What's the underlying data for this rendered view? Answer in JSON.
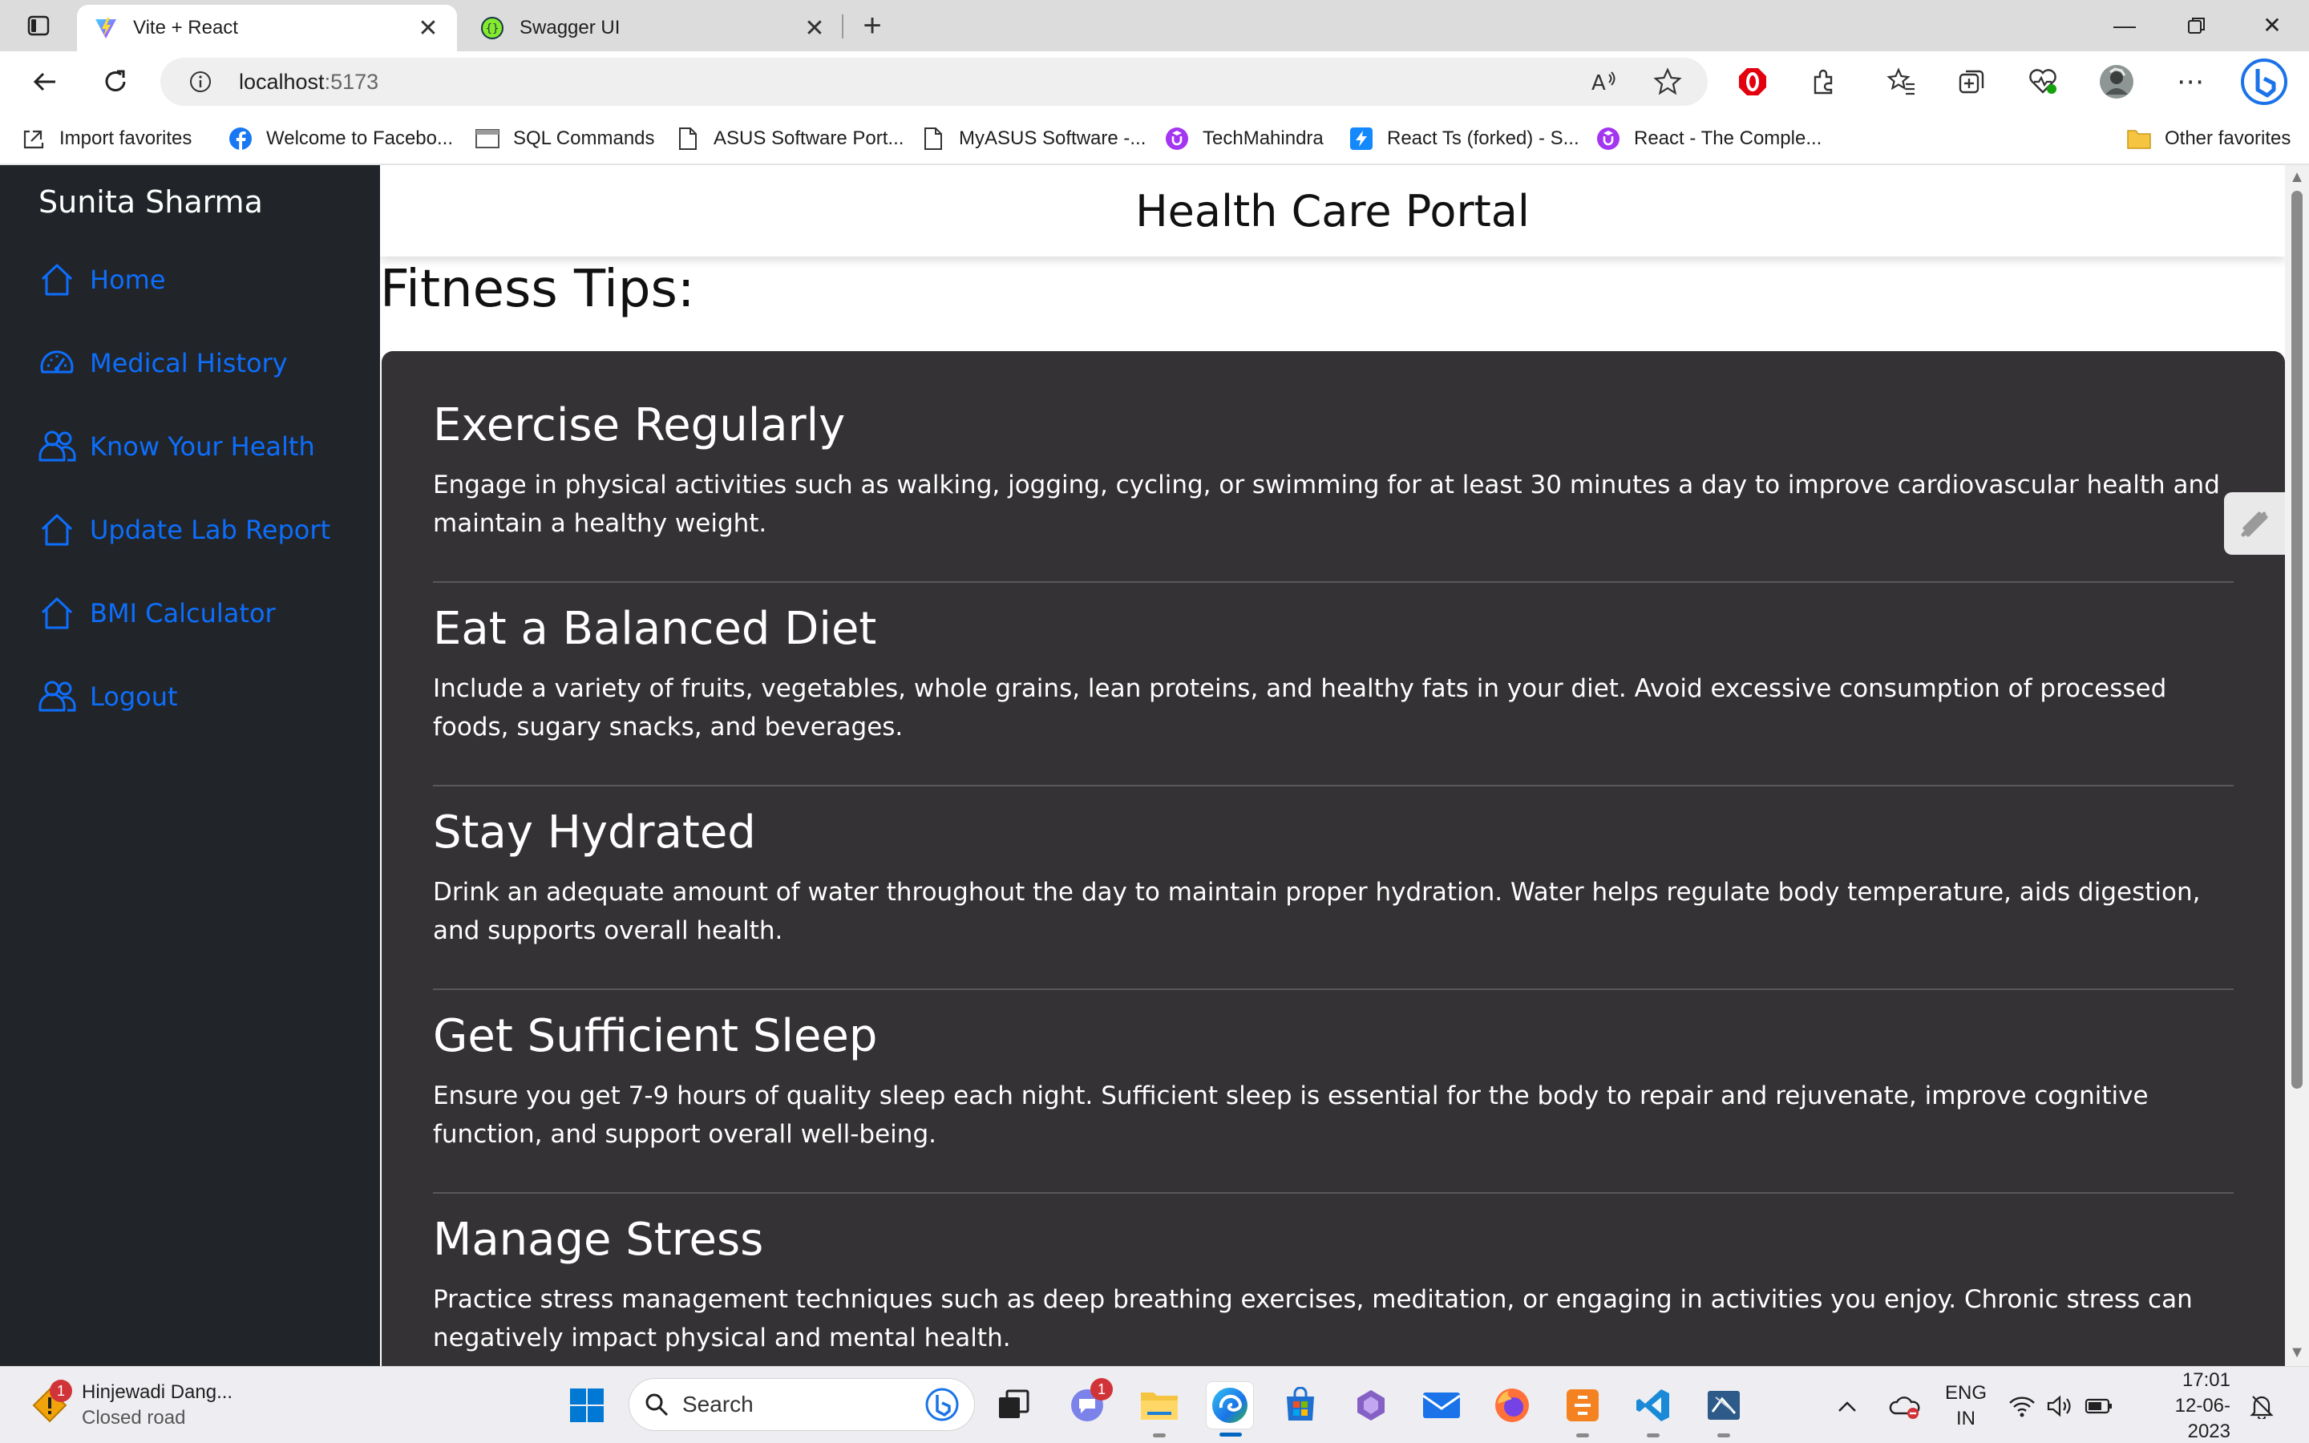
{
  "browser": {
    "tabs": [
      {
        "title": "Vite + React",
        "active": true,
        "icon": "vite-icon"
      },
      {
        "title": "Swagger UI",
        "active": false,
        "icon": "swagger-icon"
      }
    ],
    "address": {
      "host": "localhost",
      "port": ":5173"
    },
    "favorites": [
      {
        "label": "Import favorites",
        "icon": "import-icon"
      },
      {
        "label": "Welcome to Facebo...",
        "icon": "facebook-icon"
      },
      {
        "label": "SQL Commands",
        "icon": "page-icon"
      },
      {
        "label": "ASUS Software Port...",
        "icon": "document-icon"
      },
      {
        "label": "MyASUS Software -...",
        "icon": "document-icon"
      },
      {
        "label": "TechMahindra",
        "icon": "udemy-icon"
      },
      {
        "label": "React Ts (forked) - S...",
        "icon": "stackblitz-icon"
      },
      {
        "label": "React - The Comple...",
        "icon": "udemy-icon"
      }
    ],
    "other_favorites": "Other favorites"
  },
  "app": {
    "user_name": "Sunita Sharma",
    "header_title": "Health Care Portal",
    "nav": [
      {
        "label": "Home",
        "icon": "home-icon"
      },
      {
        "label": "Medical History",
        "icon": "dashboard-icon"
      },
      {
        "label": "Know Your Health",
        "icon": "people-icon"
      },
      {
        "label": "Update Lab Report",
        "icon": "home-icon"
      },
      {
        "label": "BMI Calculator",
        "icon": "home-icon"
      },
      {
        "label": "Logout",
        "icon": "people-icon"
      }
    ],
    "section_title": "Fitness Tips:",
    "tips": [
      {
        "title": "Exercise Regularly",
        "text": "Engage in physical activities such as walking, jogging, cycling, or swimming for at least 30 minutes a day to improve cardiovascular health and maintain a healthy weight."
      },
      {
        "title": "Eat a Balanced Diet",
        "text": "Include a variety of fruits, vegetables, whole grains, lean proteins, and healthy fats in your diet. Avoid excessive consumption of processed foods, sugary snacks, and beverages."
      },
      {
        "title": "Stay Hydrated",
        "text": "Drink an adequate amount of water throughout the day to maintain proper hydration. Water helps regulate body temperature, aids digestion, and supports overall health."
      },
      {
        "title": "Get Sufficient Sleep",
        "text": "Ensure you get 7-9 hours of quality sleep each night. Sufficient sleep is essential for the body to repair and rejuvenate, improve cognitive function, and support overall well-being."
      },
      {
        "title": "Manage Stress",
        "text": "Practice stress management techniques such as deep breathing exercises, meditation, or engaging in activities you enjoy. Chronic stress can negatively impact physical and mental health."
      }
    ]
  },
  "taskbar": {
    "weather": {
      "title": "Hinjewadi Dang...",
      "subtitle": "Closed road",
      "badge": "1"
    },
    "search_placeholder": "Search",
    "teams_badge": "1",
    "language": {
      "line1": "ENG",
      "line2": "IN"
    },
    "clock": {
      "time": "17:01",
      "date": "12-06-2023"
    }
  },
  "colors": {
    "sidebar_bg": "#212529",
    "nav_link": "#0d6efd",
    "card_bg": "#343234",
    "accent": "#0067c0"
  }
}
